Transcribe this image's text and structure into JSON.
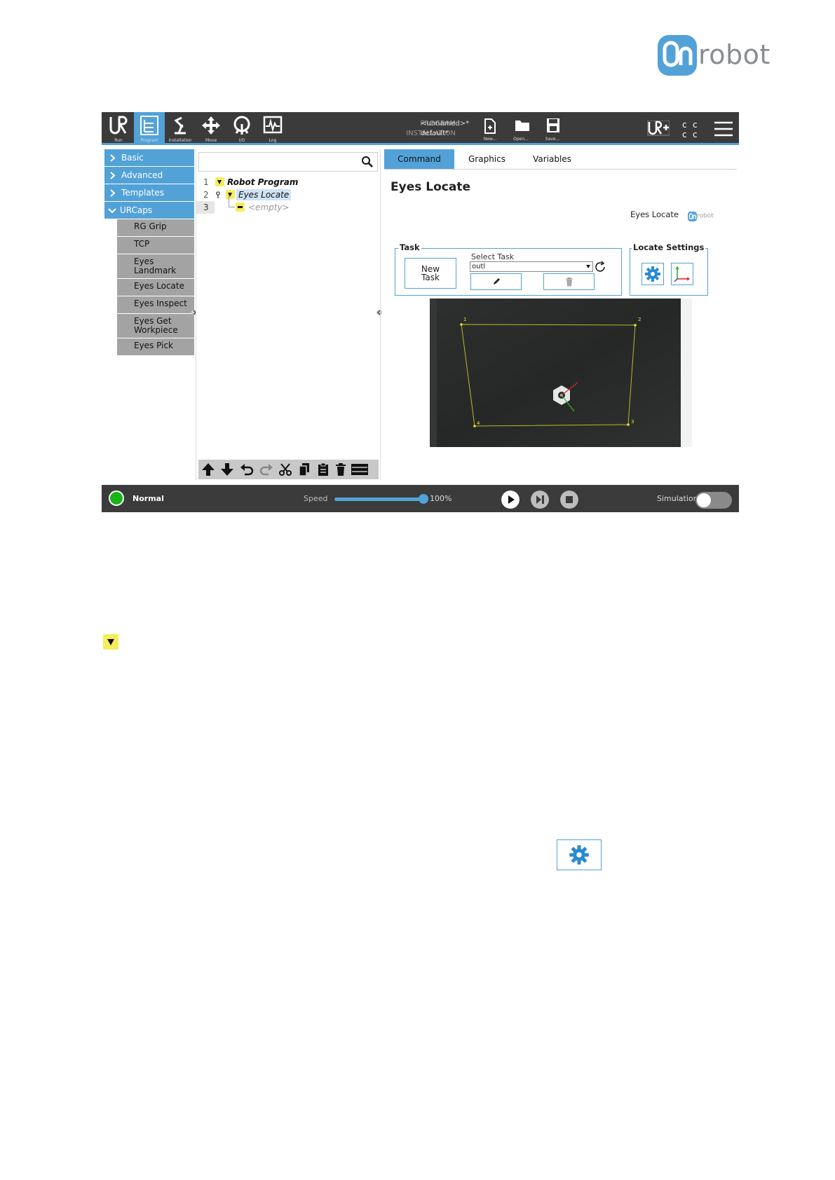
{
  "brand": {
    "logo_word": "robot",
    "logo_mark": "On",
    "accent": "#52a2d8"
  },
  "topbar": {
    "nav": [
      {
        "label": "Run",
        "icon": "ur-logo-icon"
      },
      {
        "label": "Program",
        "icon": "program-tree-icon",
        "active": true
      },
      {
        "label": "Installation",
        "icon": "robot-arm-icon"
      },
      {
        "label": "Move",
        "icon": "move-arrows-icon"
      },
      {
        "label": "I/O",
        "icon": "io-icon"
      },
      {
        "label": "Log",
        "icon": "log-chart-icon"
      }
    ],
    "program_label": "PROGRAM",
    "program_value": "<unnamed>*",
    "installation_label": "INSTALLATION",
    "installation_value": "default*",
    "file_buttons": [
      {
        "label": "New...",
        "icon": "new-file-icon"
      },
      {
        "label": "Open...",
        "icon": "folder-icon"
      },
      {
        "label": "Save...",
        "icon": "save-icon"
      }
    ]
  },
  "nodes": {
    "categories": [
      {
        "label": "Basic",
        "expanded": false
      },
      {
        "label": "Advanced",
        "expanded": false
      },
      {
        "label": "Templates",
        "expanded": false
      },
      {
        "label": "URCaps",
        "expanded": true
      }
    ],
    "urcaps_items": [
      "RG Grip",
      "TCP",
      "Eyes Landmark",
      "Eyes Locate",
      "Eyes Inspect",
      "Eyes Get Workpiece",
      "Eyes Pick"
    ]
  },
  "tree": {
    "lines": [
      {
        "num": "1",
        "text": "Robot Program"
      },
      {
        "num": "2",
        "text": "Eyes Locate"
      },
      {
        "num": "3",
        "text": "<empty>"
      }
    ]
  },
  "right": {
    "tabs": [
      "Command",
      "Graphics",
      "Variables"
    ],
    "active_tab": "Command",
    "title": "Eyes Locate",
    "cap_label": "Eyes Locate",
    "cap_logo_word": "robot",
    "task_legend": "Task",
    "new_task_label": "New\nTask",
    "select_task_label": "Select Task",
    "select_task_value": "outl",
    "settings_legend": "Locate Settings",
    "corner_labels": [
      "1",
      "2",
      "3",
      "4"
    ]
  },
  "footer": {
    "status": "Normal",
    "status_color": "#18b418",
    "speed_label": "Speed",
    "speed_value": "100%",
    "speed_fraction": 1.0,
    "simulation_label": "Simulation",
    "simulation_on": false
  }
}
